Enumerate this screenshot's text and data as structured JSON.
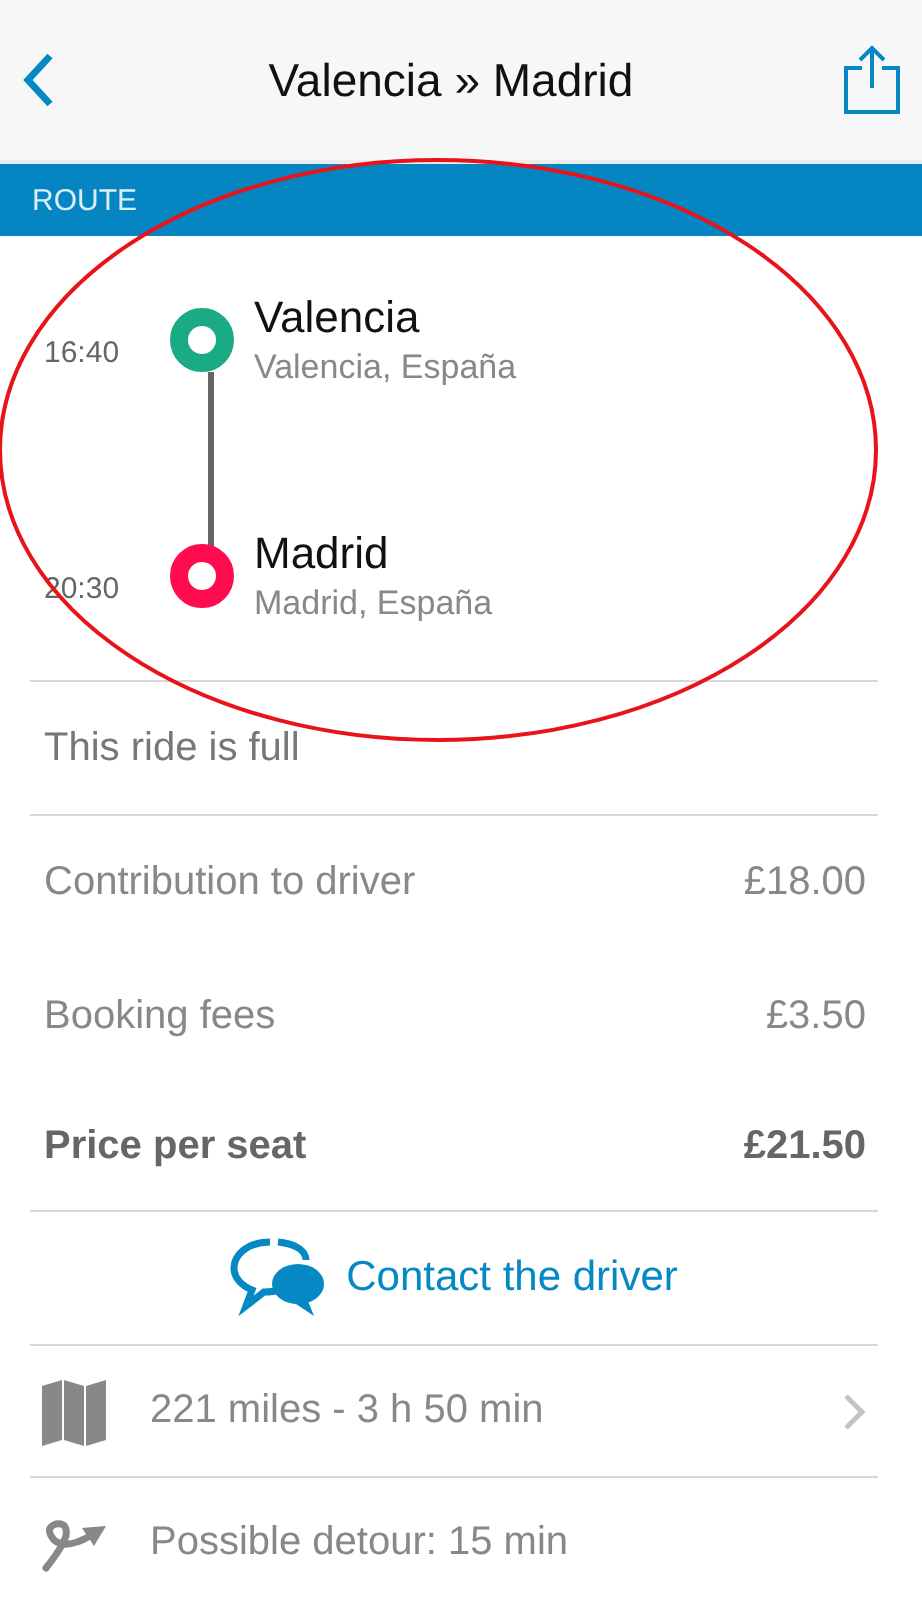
{
  "header": {
    "title": "Valencia » Madrid"
  },
  "section": {
    "label": "ROUTE"
  },
  "stops": [
    {
      "time": "16:40",
      "city": "Valencia",
      "place": "Valencia, España",
      "color": "#1aab84"
    },
    {
      "time": "20:30",
      "city": "Madrid",
      "place": "Madrid, España",
      "color": "#ff0b4f"
    }
  ],
  "status": "This ride is full",
  "prices": [
    {
      "label": "Contribution to driver",
      "amount": "£18.00",
      "kind": "normal"
    },
    {
      "label": "Booking fees",
      "amount": "£3.50",
      "kind": "normal"
    },
    {
      "label": "Price per seat",
      "amount": "£21.50",
      "kind": "total"
    }
  ],
  "contact": {
    "label": "Contact the driver"
  },
  "details": [
    {
      "kind": "map",
      "text": "221 miles - 3 h 50 min",
      "chevron": true
    },
    {
      "kind": "detour",
      "text": "Possible detour: 15 min",
      "chevron": false
    }
  ]
}
